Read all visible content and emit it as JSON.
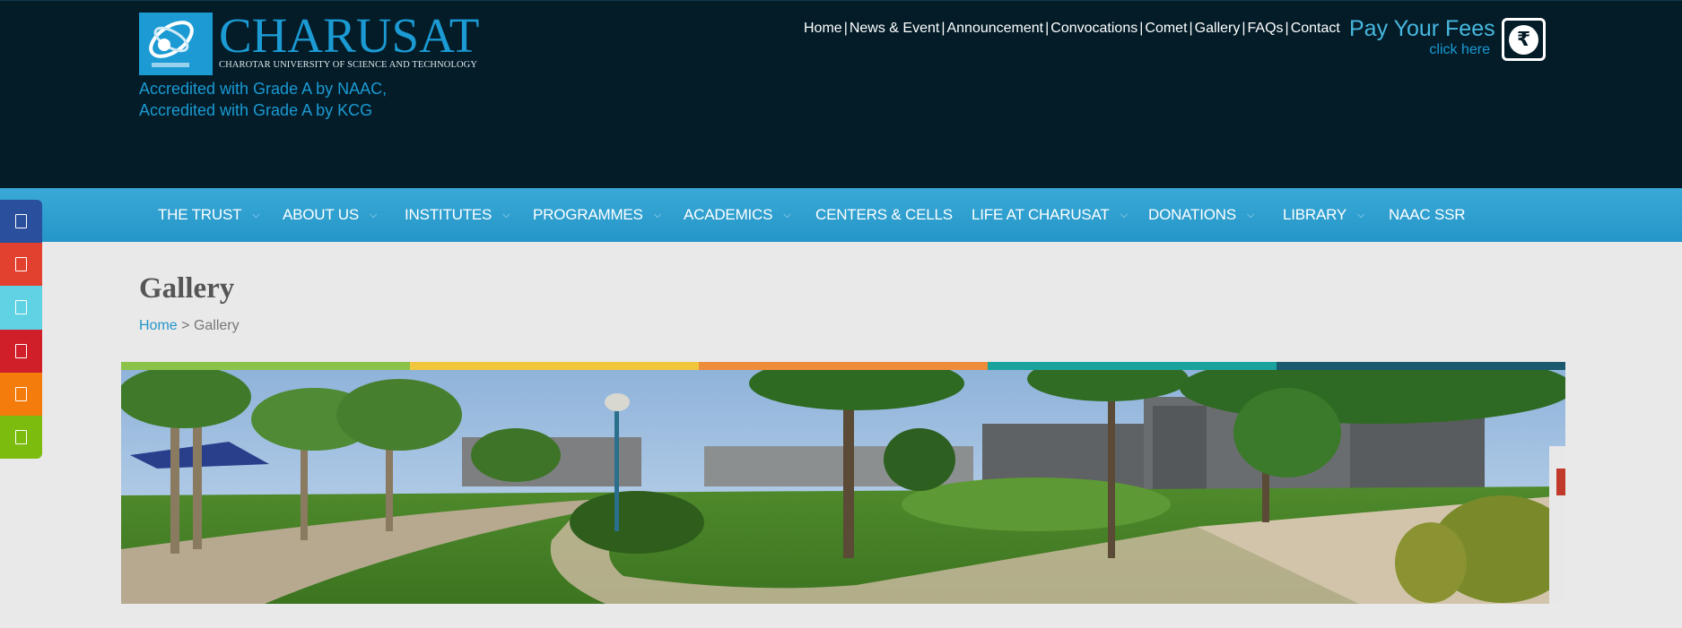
{
  "brand": {
    "name": "CHARUSAT",
    "tagline": "CHAROTAR UNIVERSITY OF SCIENCE AND TECHNOLOGY",
    "accent_color": "#1b9ad3",
    "accreditation_line1": "Accredited with Grade A by NAAC,",
    "accreditation_line2": "Accredited with Grade A by KCG"
  },
  "top_links": [
    "Home",
    "News & Event",
    "Announcement",
    "Convocations",
    "Comet",
    "Gallery",
    "FAQs",
    "Contact"
  ],
  "fees": {
    "title": "Pay Your Fees",
    "link": "click here",
    "icon": "rupee-icon",
    "icon_glyph": "₹"
  },
  "nav": {
    "items": [
      {
        "label": "THE TRUST",
        "has_dropdown": true
      },
      {
        "label": "ABOUT US",
        "has_dropdown": true
      },
      {
        "label": "INSTITUTES",
        "has_dropdown": true
      },
      {
        "label": "PROGRAMMES",
        "has_dropdown": true
      },
      {
        "label": "ACADEMICS",
        "has_dropdown": true
      },
      {
        "label": "CENTERS & CELLS",
        "has_dropdown": false
      },
      {
        "label": "LIFE AT CHARUSAT",
        "has_dropdown": true
      },
      {
        "label": "DONATIONS",
        "has_dropdown": true
      },
      {
        "label": "LIBRARY",
        "has_dropdown": true
      },
      {
        "label": "NAAC SSR",
        "has_dropdown": false
      }
    ],
    "background_color": "#2c9fcf"
  },
  "social": [
    {
      "icon": "facebook-icon",
      "color": "#2a4f9c"
    },
    {
      "icon": "google-plus-icon",
      "color": "#e2412f"
    },
    {
      "icon": "twitter-icon",
      "color": "#5fd3e3"
    },
    {
      "icon": "youtube-icon",
      "color": "#d11f2a"
    },
    {
      "icon": "blogger-icon",
      "color": "#f47c0d"
    },
    {
      "icon": "share-icon",
      "color": "#7bbc0f"
    }
  ],
  "page": {
    "title": "Gallery",
    "breadcrumb_home": "Home",
    "breadcrumb_separator": ">",
    "breadcrumb_current": "Gallery"
  },
  "color_strip": [
    "#8bc34a",
    "#f0c73c",
    "#ee8c3a",
    "#1aa39c",
    "#1b5a6e"
  ],
  "banner": {
    "image": "campus-panorama"
  }
}
